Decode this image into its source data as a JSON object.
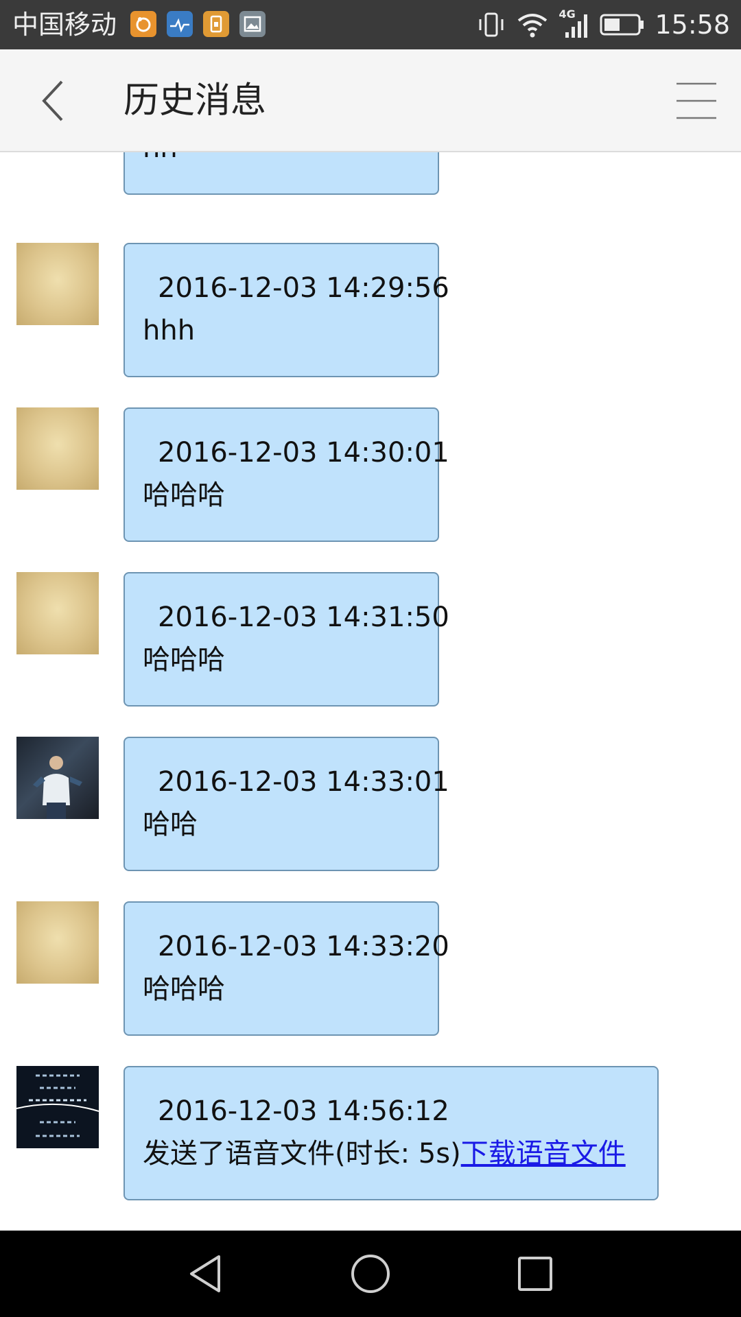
{
  "status_bar": {
    "carrier": "中国移动",
    "network": "4G",
    "time": "15:58",
    "icons": [
      "uc-browser-icon",
      "health-app-icon",
      "sim-app-icon",
      "gallery-icon",
      "vibrate-icon",
      "wifi-icon",
      "signal-icon",
      "battery-icon"
    ]
  },
  "header": {
    "title": "历史消息",
    "back_icon": "chevron-left-icon",
    "menu_icon": "hamburger-menu-icon"
  },
  "messages": [
    {
      "avatar": "dark-photo-avatar",
      "timestamp": "",
      "text": "hh"
    },
    {
      "avatar": "paper-texture-avatar",
      "timestamp": "2016-12-03 14:29:56",
      "text": "hhh"
    },
    {
      "avatar": "paper-texture-avatar",
      "timestamp": "2016-12-03 14:30:01",
      "text": "哈哈哈"
    },
    {
      "avatar": "paper-texture-avatar",
      "timestamp": "2016-12-03 14:31:50",
      "text": "哈哈哈"
    },
    {
      "avatar": "person-photo-avatar",
      "timestamp": "2016-12-03 14:33:01",
      "text": "哈哈"
    },
    {
      "avatar": "paper-texture-avatar",
      "timestamp": "2016-12-03 14:33:20",
      "text": "哈哈哈"
    },
    {
      "avatar": "chinese-text-avatar",
      "timestamp": "2016-12-03 14:56:12",
      "text": "发送了语音文件(时长: 5s)",
      "link": "下载语音文件"
    }
  ],
  "nav_bar": {
    "icons": [
      "back-triangle-icon",
      "home-circle-icon",
      "recents-square-icon"
    ]
  },
  "colors": {
    "bubble_fill": "#c0e2fc",
    "bubble_border": "#6d94b2",
    "link": "#1a1ae6",
    "header_bg": "#f5f5f5",
    "status_bg": "#3a3a3a"
  }
}
